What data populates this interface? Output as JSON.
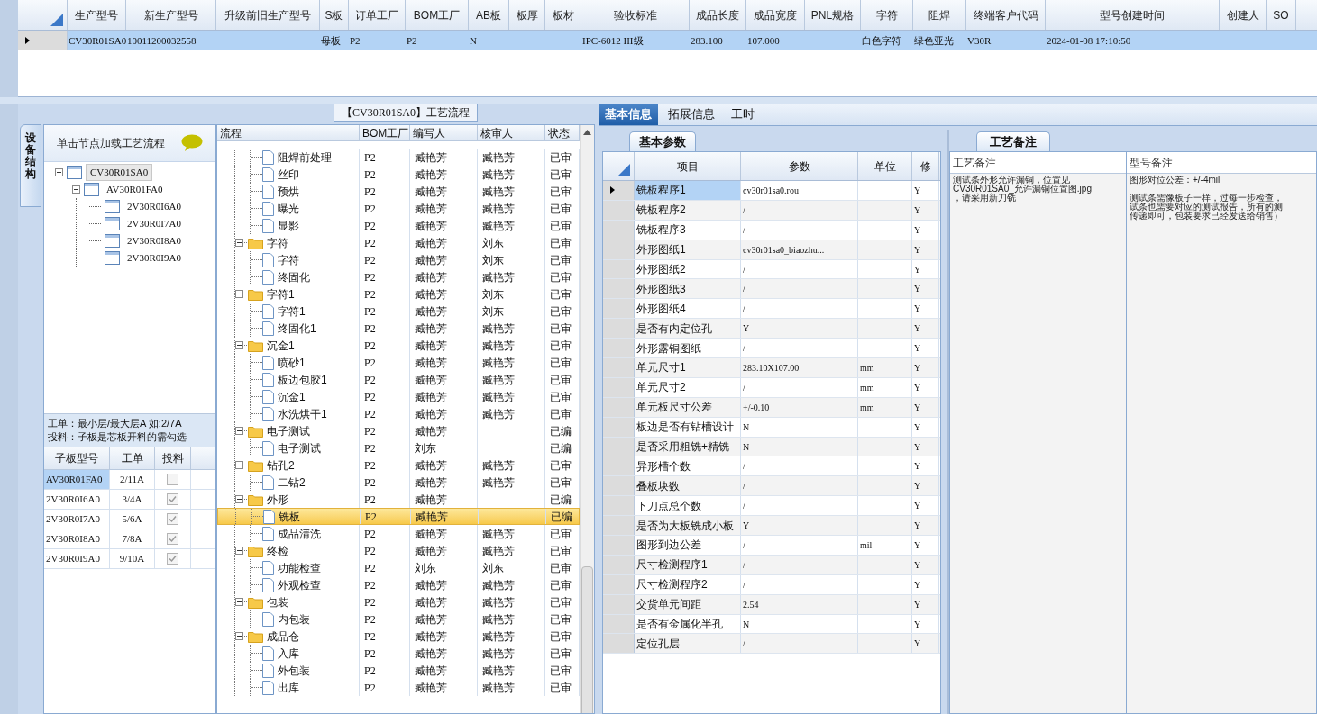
{
  "top_grid": {
    "columns": [
      "生产型号",
      "新生产型号",
      "升级前旧生产型号",
      "S板",
      "订单工厂",
      "BOM工厂",
      "AB板",
      "板厚",
      "板材",
      "验收标准",
      "成品长度",
      "成品宽度",
      "PNL规格",
      "字符",
      "阻焊",
      "终端客户代码",
      "型号创建时间",
      "创建人",
      "SO"
    ],
    "rows": [
      {
        "selected": true,
        "cells": [
          "CV30R01SA0",
          "10011200032558",
          null,
          "母板",
          "P2",
          "P2",
          "N",
          null,
          null,
          "IPC-6012 III级",
          "283.100",
          "107.000",
          null,
          "白色字符",
          "绿色亚光",
          "V30R",
          "2024-01-08 17:10:50",
          null,
          null
        ]
      }
    ]
  },
  "left_panel": {
    "side_tab": "设备结构",
    "header": "单击节点加载工艺流程",
    "tree": [
      {
        "label": "CV30R01SA0",
        "selected": true,
        "expanded": true,
        "children": [
          {
            "label": "AV30R01FA0",
            "selected": false,
            "expanded": true,
            "children": [
              {
                "label": "2V30R0I6A0",
                "selected": false
              },
              {
                "label": "2V30R0I7A0",
                "selected": false
              },
              {
                "label": "2V30R0I8A0",
                "selected": false
              },
              {
                "label": "2V30R0I9A0",
                "selected": false
              }
            ]
          }
        ]
      }
    ],
    "note": [
      "工单：最小层/最大层A 如:2/7A",
      "投料：子板是芯板开料的需勾选"
    ],
    "sub_table": {
      "columns": [
        "子板型号",
        "工单",
        "投料"
      ],
      "rows": [
        {
          "model": "AV30R01FA0",
          "order": "2/11A",
          "checked": false,
          "selected": true
        },
        {
          "model": "2V30R0I6A0",
          "order": "3/4A",
          "checked": true,
          "selected": false
        },
        {
          "model": "2V30R0I7A0",
          "order": "5/6A",
          "checked": true,
          "selected": false
        },
        {
          "model": "2V30R0I8A0",
          "order": "7/8A",
          "checked": true,
          "selected": false
        },
        {
          "model": "2V30R0I9A0",
          "order": "9/10A",
          "checked": true,
          "selected": false
        }
      ]
    }
  },
  "flow_panel": {
    "title": "【CV30R01SA0】工艺流程",
    "columns": [
      "流程",
      "BOM工厂",
      "编写人",
      "核审人",
      "状态"
    ],
    "groups": [
      {
        "children": [
          {
            "name": "阻焊前处理",
            "bom": "P2",
            "writer": "臧艳芳",
            "reviewer": "臧艳芳",
            "status": "已审",
            "selected": false
          },
          {
            "name": "丝印",
            "bom": "P2",
            "writer": "臧艳芳",
            "reviewer": "臧艳芳",
            "status": "已审",
            "selected": false
          },
          {
            "name": "预烘",
            "bom": "P2",
            "writer": "臧艳芳",
            "reviewer": "臧艳芳",
            "status": "已审",
            "selected": false
          },
          {
            "name": "曝光",
            "bom": "P2",
            "writer": "臧艳芳",
            "reviewer": "臧艳芳",
            "status": "已审",
            "selected": false
          },
          {
            "name": "显影",
            "bom": "P2",
            "writer": "臧艳芳",
            "reviewer": "臧艳芳",
            "status": "已审",
            "selected": false
          }
        ]
      },
      {
        "name": "字符",
        "bom": "P2",
        "writer": "臧艳芳",
        "reviewer": "刘东",
        "status": "已审",
        "selected": false,
        "expanded": true,
        "children": [
          {
            "name": "字符",
            "bom": "P2",
            "writer": "臧艳芳",
            "reviewer": "刘东",
            "status": "已审",
            "selected": false
          },
          {
            "name": "终固化",
            "bom": "P2",
            "writer": "臧艳芳",
            "reviewer": "臧艳芳",
            "status": "已审",
            "selected": false
          }
        ]
      },
      {
        "name": "字符1",
        "bom": "P2",
        "writer": "臧艳芳",
        "reviewer": "刘东",
        "status": "已审",
        "selected": false,
        "expanded": true,
        "children": [
          {
            "name": "字符1",
            "bom": "P2",
            "writer": "臧艳芳",
            "reviewer": "刘东",
            "status": "已审",
            "selected": false
          },
          {
            "name": "终固化1",
            "bom": "P2",
            "writer": "臧艳芳",
            "reviewer": "臧艳芳",
            "status": "已审",
            "selected": false
          }
        ]
      },
      {
        "name": "沉金1",
        "bom": "P2",
        "writer": "臧艳芳",
        "reviewer": "臧艳芳",
        "status": "已审",
        "selected": false,
        "expanded": true,
        "children": [
          {
            "name": "喷砂1",
            "bom": "P2",
            "writer": "臧艳芳",
            "reviewer": "臧艳芳",
            "status": "已审",
            "selected": false
          },
          {
            "name": "板边包胶1",
            "bom": "P2",
            "writer": "臧艳芳",
            "reviewer": "臧艳芳",
            "status": "已审",
            "selected": false
          },
          {
            "name": "沉金1",
            "bom": "P2",
            "writer": "臧艳芳",
            "reviewer": "臧艳芳",
            "status": "已审",
            "selected": false
          },
          {
            "name": "水洗烘干1",
            "bom": "P2",
            "writer": "臧艳芳",
            "reviewer": "臧艳芳",
            "status": "已审",
            "selected": false
          }
        ]
      },
      {
        "name": "电子测试",
        "bom": "P2",
        "writer": "臧艳芳",
        "status": "已编",
        "selected": false,
        "expanded": true,
        "children": [
          {
            "name": "电子测试",
            "bom": "P2",
            "writer": "刘东",
            "status": "已编",
            "selected": false
          }
        ]
      },
      {
        "name": "钻孔2",
        "bom": "P2",
        "writer": "臧艳芳",
        "reviewer": "臧艳芳",
        "status": "已审",
        "selected": false,
        "expanded": true,
        "children": [
          {
            "name": "二钻2",
            "bom": "P2",
            "writer": "臧艳芳",
            "reviewer": "臧艳芳",
            "status": "已审",
            "selected": false
          }
        ]
      },
      {
        "name": "外形",
        "bom": "P2",
        "writer": "臧艳芳",
        "status": "已编",
        "selected": false,
        "expanded": true,
        "children": [
          {
            "name": "铣板",
            "bom": "P2",
            "writer": "臧艳芳",
            "status": "已编",
            "selected": true
          },
          {
            "name": "成品清洗",
            "bom": "P2",
            "writer": "臧艳芳",
            "reviewer": "臧艳芳",
            "status": "已审",
            "selected": false
          }
        ]
      },
      {
        "name": "终检",
        "bom": "P2",
        "writer": "臧艳芳",
        "reviewer": "臧艳芳",
        "status": "已审",
        "selected": false,
        "expanded": true,
        "children": [
          {
            "name": "功能检查",
            "bom": "P2",
            "writer": "刘东",
            "reviewer": "刘东",
            "status": "已审",
            "selected": false
          },
          {
            "name": "外观检查",
            "bom": "P2",
            "writer": "臧艳芳",
            "reviewer": "臧艳芳",
            "status": "已审",
            "selected": false
          }
        ]
      },
      {
        "name": "包装",
        "bom": "P2",
        "writer": "臧艳芳",
        "reviewer": "臧艳芳",
        "status": "已审",
        "selected": false,
        "expanded": true,
        "children": [
          {
            "name": "内包装",
            "bom": "P2",
            "writer": "臧艳芳",
            "reviewer": "臧艳芳",
            "status": "已审",
            "selected": false
          }
        ]
      },
      {
        "name": "成品仓",
        "bom": "P2",
        "writer": "臧艳芳",
        "reviewer": "臧艳芳",
        "status": "已审",
        "selected": false,
        "expanded": true,
        "children": [
          {
            "name": "入库",
            "bom": "P2",
            "writer": "臧艳芳",
            "reviewer": "臧艳芳",
            "status": "已审",
            "selected": false
          },
          {
            "name": "外包装",
            "bom": "P2",
            "writer": "臧艳芳",
            "reviewer": "臧艳芳",
            "status": "已审",
            "selected": false
          },
          {
            "name": "出库",
            "bom": "P2",
            "writer": "臧艳芳",
            "reviewer": "臧艳芳",
            "status": "已审",
            "selected": false
          }
        ]
      }
    ]
  },
  "right_panel": {
    "tabs": [
      {
        "label": "基本信息",
        "selected": true
      },
      {
        "label": "拓展信息",
        "selected": false
      },
      {
        "label": "工时",
        "selected": false
      }
    ],
    "params": {
      "tab": "基本参数",
      "columns": [
        "项目",
        "参数",
        "单位",
        "修"
      ],
      "rows": [
        {
          "item": "铣板程序1",
          "value": "cv30r01sa0.rou",
          "modify": "Y",
          "selected": true
        },
        {
          "item": "铣板程序2",
          "value": "/",
          "modify": "Y",
          "selected": false
        },
        {
          "item": "铣板程序3",
          "value": "/",
          "modify": "Y",
          "selected": false
        },
        {
          "item": "外形图纸1",
          "value": "cv30r01sa0_biaozhu...",
          "modify": "Y",
          "selected": false
        },
        {
          "item": "外形图纸2",
          "value": "/",
          "modify": "Y",
          "selected": false
        },
        {
          "item": "外形图纸3",
          "value": "/",
          "modify": "Y",
          "selected": false
        },
        {
          "item": "外形图纸4",
          "value": "/",
          "modify": "Y",
          "selected": false
        },
        {
          "item": "是否有内定位孔",
          "value": "Y",
          "modify": "Y",
          "selected": false
        },
        {
          "item": "外形露铜图纸",
          "value": "/",
          "modify": "Y",
          "selected": false
        },
        {
          "item": "单元尺寸1",
          "value": "283.10X107.00",
          "unit": "mm",
          "modify": "Y",
          "selected": false
        },
        {
          "item": "单元尺寸2",
          "value": "/",
          "unit": "mm",
          "modify": "Y",
          "selected": false
        },
        {
          "item": "单元板尺寸公差",
          "value": "+/-0.10",
          "unit": "mm",
          "modify": "Y",
          "selected": false
        },
        {
          "item": "板边是否有钻槽设计",
          "value": "N",
          "modify": "Y",
          "selected": false
        },
        {
          "item": "是否采用粗铣+精铣",
          "value": "N",
          "modify": "Y",
          "selected": false
        },
        {
          "item": "异形槽个数",
          "value": "/",
          "modify": "Y",
          "selected": false
        },
        {
          "item": "叠板块数",
          "value": "/",
          "modify": "Y",
          "selected": false
        },
        {
          "item": "下刀点总个数",
          "value": "/",
          "modify": "Y",
          "selected": false
        },
        {
          "item": "是否为大板铣成小板",
          "value": "Y",
          "modify": "Y",
          "selected": false
        },
        {
          "item": "图形到边公差",
          "value": "/",
          "unit": "mil",
          "modify": "Y",
          "selected": false
        },
        {
          "item": "尺寸检测程序1",
          "value": "/",
          "modify": "Y",
          "selected": false
        },
        {
          "item": "尺寸检测程序2",
          "value": "/",
          "modify": "Y",
          "selected": false
        },
        {
          "item": "交货单元间距",
          "value": "2.54",
          "modify": "Y",
          "selected": false
        },
        {
          "item": "是否有金属化半孔",
          "value": "N",
          "modify": "Y",
          "selected": false
        },
        {
          "item": "定位孔层",
          "value": "/",
          "modify": "Y",
          "selected": false
        }
      ]
    },
    "notes": {
      "tab": "工艺备注",
      "process_note": {
        "title": "工艺备注",
        "paragraphs": [
          [
            "测试条外形允许漏铜，位置见",
            "CV30R01SA0_允许漏铜位置图.jpg",
            "，请采用新刀铣"
          ]
        ]
      },
      "model_note": {
        "title": "型号备注",
        "paragraphs": [
          [
            "图形对位公差：+/-4mil"
          ],
          [
            "测试条需像板子一样，过每一步检查，",
            "试条也需要对应的测试报告，所有的测",
            "传递即可，包装要求已经发送给销售）"
          ]
        ]
      }
    }
  }
}
